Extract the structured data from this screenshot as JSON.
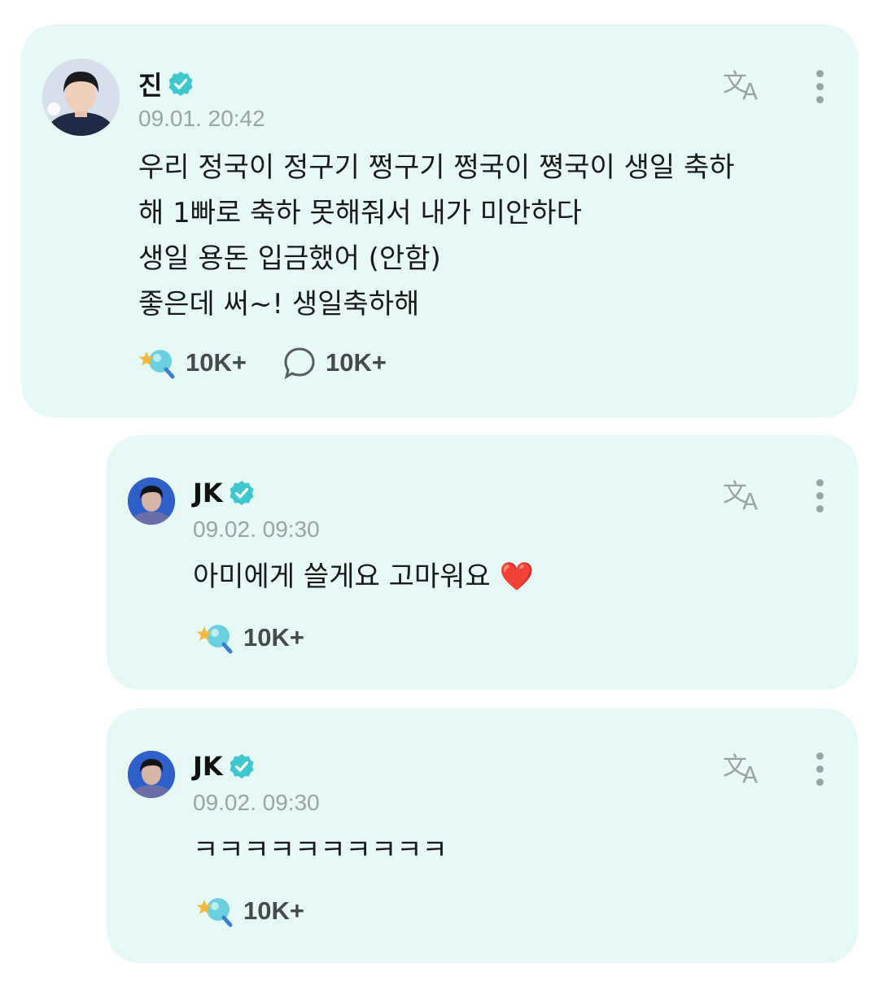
{
  "posts": [
    {
      "author": "진",
      "timestamp": "09.01. 20:42",
      "body": "우리 정국이 정구기 쩡구기 쩡국이 쪙국이 생일 축하\n해 1빠로 축하 못해줘서 내가 미안하다\n생일 용돈 입금했어 (안함)\n좋은데 써~! 생일축하해",
      "likes": "10K+",
      "comments": "10K+",
      "icons": [
        "verified-badge-icon",
        "translate-icon",
        "more-vertical-icon",
        "cheer-icon",
        "comment-bubble-icon"
      ]
    },
    {
      "author": "JK",
      "timestamp": "09.02. 09:30",
      "body": "아미에게 쓸게요 고마워요 ❤️",
      "likes": "10K+"
    },
    {
      "author": "JK",
      "timestamp": "09.02. 09:30",
      "body": "ㅋㅋㅋㅋㅋㅋㅋㅋㅋㅋ",
      "likes": "10K+"
    }
  ],
  "colors": {
    "card_bg": "#e6f9f6",
    "verified": "#3ec7cf",
    "meta_gray": "#9aa3a8",
    "heart": "#e0262d"
  }
}
